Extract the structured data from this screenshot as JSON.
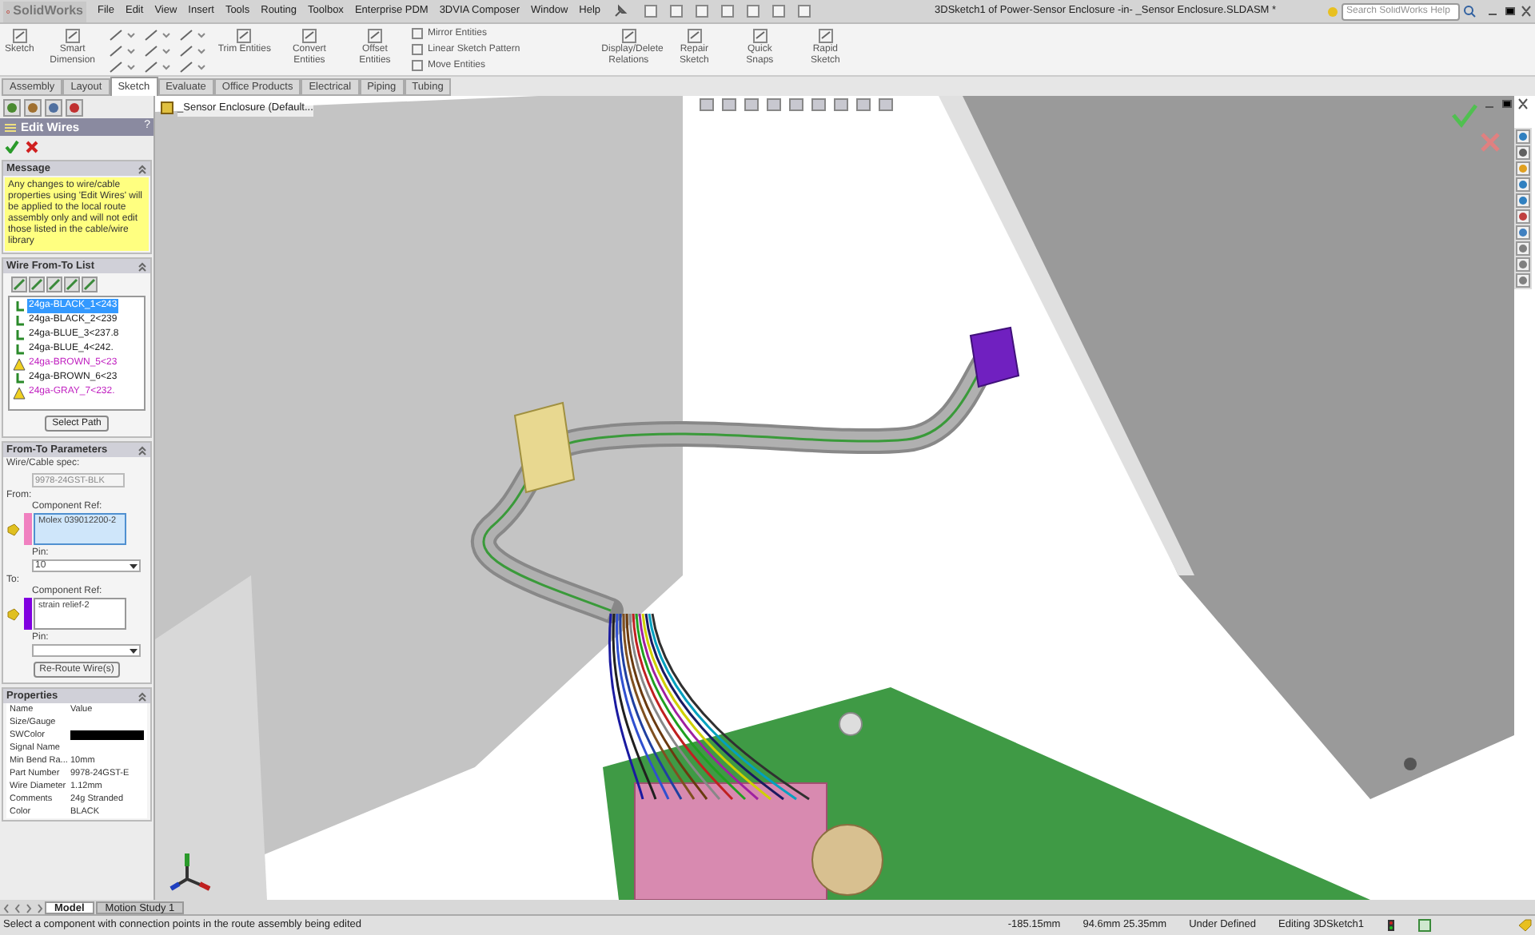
{
  "app": {
    "logo": "SolidWorks",
    "menu": [
      "File",
      "Edit",
      "View",
      "Insert",
      "Tools",
      "Routing",
      "Toolbox",
      "Enterprise PDM",
      "3DVIA Composer",
      "Window",
      "Help"
    ],
    "title": "3DSketch1 of Power-Sensor Enclosure -in- _Sensor Enclosure.SLDASM *",
    "search": {
      "placeholder": "Search SolidWorks Help"
    }
  },
  "ribbon": {
    "large": [
      {
        "label": "Sketch"
      },
      {
        "label": "Smart Dimension"
      }
    ],
    "large2": [
      {
        "label": "Trim Entities"
      },
      {
        "label": "Convert Entities"
      },
      {
        "label": "Offset Entities"
      }
    ],
    "small": [
      "Mirror Entities",
      "Linear Sketch Pattern",
      "Move Entities"
    ],
    "large3": [
      {
        "label": "Display/Delete Relations"
      },
      {
        "label": "Repair Sketch"
      },
      {
        "label": "Quick Snaps"
      },
      {
        "label": "Rapid Sketch"
      }
    ]
  },
  "tabs": [
    {
      "label": "Assembly",
      "selected": false
    },
    {
      "label": "Layout",
      "selected": false
    },
    {
      "label": "Sketch",
      "selected": true
    },
    {
      "label": "Evaluate",
      "selected": false
    },
    {
      "label": "Office Products",
      "selected": false
    },
    {
      "label": "Electrical",
      "selected": false
    },
    {
      "label": "Piping",
      "selected": false
    },
    {
      "label": "Tubing",
      "selected": false
    }
  ],
  "panel": {
    "title": "Edit Wires",
    "help": "?",
    "message": {
      "title": "Message",
      "text": "Any changes to wire/cable properties using 'Edit Wires' will be applied to the local route assembly only and will not edit those listed in the cable/wire library"
    },
    "wire_list": {
      "title": "Wire From-To List",
      "button": "Select Path",
      "items": [
        {
          "label": "24ga-BLACK_1<243",
          "warning": false,
          "selected": true
        },
        {
          "label": "24ga-BLACK_2<239",
          "warning": false,
          "selected": false
        },
        {
          "label": "24ga-BLUE_3<237.8",
          "warning": false,
          "selected": false
        },
        {
          "label": "24ga-BLUE_4<242.",
          "warning": false,
          "selected": false
        },
        {
          "label": "24ga-BROWN_5<23",
          "warning": true,
          "selected": false
        },
        {
          "label": "24ga-BROWN_6<23",
          "warning": false,
          "selected": false
        },
        {
          "label": "24ga-GRAY_7<232.",
          "warning": true,
          "selected": false
        }
      ]
    },
    "params": {
      "title": "From-To Parameters",
      "spec_label": "Wire/Cable spec:",
      "spec_value": "9978-24GST-BLK",
      "ends": [
        {
          "heading": "From:",
          "ref_label": "Component Ref:",
          "ref": "Molex 039012200-2",
          "color": "#f080c0",
          "pin_label": "Pin:",
          "pin": "10"
        },
        {
          "heading": "To:",
          "ref_label": "Component Ref:",
          "ref": "strain relief-2",
          "color": "#8000e0",
          "pin_label": "Pin:"
        }
      ],
      "button": "Re-Route Wire(s)"
    },
    "properties": {
      "title": "Properties",
      "columns": [
        "Name",
        "Value"
      ],
      "rows": [
        {
          "name": "Size/Gauge"
        },
        {
          "name": "SWColor",
          "color": "#000000"
        },
        {
          "name": "Signal Name"
        },
        {
          "name": "Min Bend Ra...",
          "value": "10mm"
        },
        {
          "name": "Part Number",
          "value": "9978-24GST-E"
        },
        {
          "name": "Wire Diameter",
          "value": "1.12mm"
        },
        {
          "name": "Comments",
          "value": "24g Stranded"
        },
        {
          "name": "Color",
          "value": "BLACK"
        }
      ]
    }
  },
  "viewport": {
    "tree_label": "_Sensor Enclosure  (Default..."
  },
  "bottom_tabs": [
    {
      "label": "Model",
      "selected": true
    },
    {
      "label": "Motion Study 1",
      "selected": false
    }
  ],
  "status_bar": {
    "prompt": "Select a component with connection points in the route assembly being edited",
    "x": "-185.15mm",
    "yz": "94.6mm 25.35mm",
    "state": "Under Defined",
    "editing": "Editing 3DSketch1"
  }
}
